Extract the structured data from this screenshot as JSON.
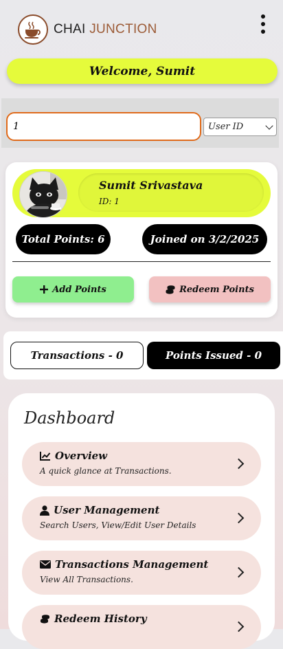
{
  "header": {
    "brand_part1": "CHAI",
    "brand_part2": "JUNCTION",
    "logo_icon": "tea-cup-icon",
    "menu_icon": "kebab-menu-icon"
  },
  "welcome": "Welcome, Sumit",
  "search": {
    "value": "1",
    "select_value": "User ID"
  },
  "user": {
    "name": "Sumit Srivastava",
    "id_label": "ID: 1",
    "total_points": "Total Points: 6",
    "joined": "Joined on 3/2/2025"
  },
  "actions": {
    "add_points": "Add Points",
    "redeem_points": "Redeem Points"
  },
  "stats": {
    "transactions": "Transactions - 0",
    "points_issued": "Points Issued - 0"
  },
  "dashboard": {
    "title": "Dashboard",
    "items": [
      {
        "title": "Overview",
        "subtitle": "A quick glance at Transactions.",
        "icon": "chart-line-icon"
      },
      {
        "title": "User Management",
        "subtitle": "Search Users, View/Edit User Details",
        "icon": "user-icon"
      },
      {
        "title": "Transactions Management",
        "subtitle": "View All Transactions.",
        "icon": "envelope-icon"
      },
      {
        "title": "Redeem History",
        "subtitle": "",
        "icon": "coins-icon"
      }
    ]
  },
  "colors": {
    "accent_yellow": "#e5fb3b",
    "add_green": "#8fee8f",
    "redeem_pink": "#f2c1c1",
    "search_border": "#e06a1a",
    "menu_item_bg": "#f5e2de"
  }
}
